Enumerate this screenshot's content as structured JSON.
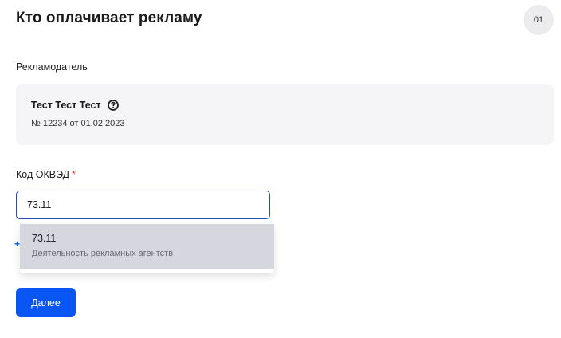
{
  "header": {
    "title": "Кто оплачивает рекламу",
    "step_number": "01"
  },
  "advertiser": {
    "section_label": "Рекламодатель",
    "name": "Тест Тест Тест",
    "contract": "№ 12234 от 01.02.2023",
    "help_icon": "question-circle-icon"
  },
  "okved": {
    "label": "Код ОКВЭД",
    "required_mark": "*",
    "value": "73.11",
    "suggestions": [
      {
        "code": "73.11",
        "description": "Деятельность рекламных агентств"
      }
    ]
  },
  "actions": {
    "next_label": "Далее"
  },
  "colors": {
    "accent": "#0a56f5",
    "input_focus_border": "#1f4fb8",
    "required": "#e53935",
    "card_bg": "#f5f5f7",
    "option_highlight": "#d5d6de"
  }
}
